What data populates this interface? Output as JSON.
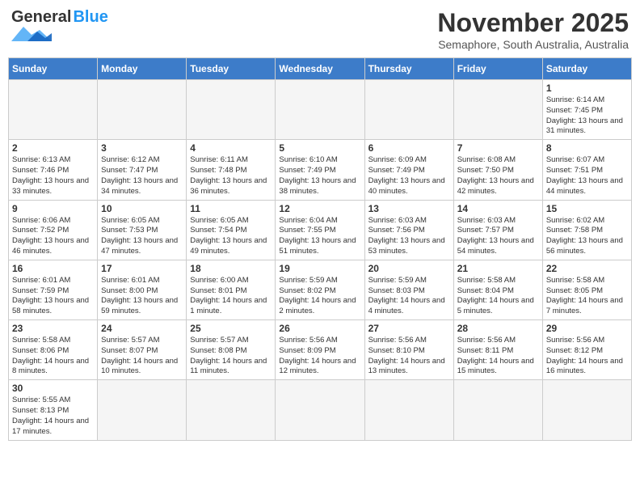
{
  "header": {
    "logo_general": "General",
    "logo_blue": "Blue",
    "title": "November 2025",
    "location": "Semaphore, South Australia, Australia"
  },
  "days_of_week": [
    "Sunday",
    "Monday",
    "Tuesday",
    "Wednesday",
    "Thursday",
    "Friday",
    "Saturday"
  ],
  "weeks": [
    [
      {
        "day": "",
        "info": ""
      },
      {
        "day": "",
        "info": ""
      },
      {
        "day": "",
        "info": ""
      },
      {
        "day": "",
        "info": ""
      },
      {
        "day": "",
        "info": ""
      },
      {
        "day": "",
        "info": ""
      },
      {
        "day": "1",
        "info": "Sunrise: 6:14 AM\nSunset: 7:45 PM\nDaylight: 13 hours and 31 minutes."
      }
    ],
    [
      {
        "day": "2",
        "info": "Sunrise: 6:13 AM\nSunset: 7:46 PM\nDaylight: 13 hours and 33 minutes."
      },
      {
        "day": "3",
        "info": "Sunrise: 6:12 AM\nSunset: 7:47 PM\nDaylight: 13 hours and 34 minutes."
      },
      {
        "day": "4",
        "info": "Sunrise: 6:11 AM\nSunset: 7:48 PM\nDaylight: 13 hours and 36 minutes."
      },
      {
        "day": "5",
        "info": "Sunrise: 6:10 AM\nSunset: 7:49 PM\nDaylight: 13 hours and 38 minutes."
      },
      {
        "day": "6",
        "info": "Sunrise: 6:09 AM\nSunset: 7:49 PM\nDaylight: 13 hours and 40 minutes."
      },
      {
        "day": "7",
        "info": "Sunrise: 6:08 AM\nSunset: 7:50 PM\nDaylight: 13 hours and 42 minutes."
      },
      {
        "day": "8",
        "info": "Sunrise: 6:07 AM\nSunset: 7:51 PM\nDaylight: 13 hours and 44 minutes."
      }
    ],
    [
      {
        "day": "9",
        "info": "Sunrise: 6:06 AM\nSunset: 7:52 PM\nDaylight: 13 hours and 46 minutes."
      },
      {
        "day": "10",
        "info": "Sunrise: 6:05 AM\nSunset: 7:53 PM\nDaylight: 13 hours and 47 minutes."
      },
      {
        "day": "11",
        "info": "Sunrise: 6:05 AM\nSunset: 7:54 PM\nDaylight: 13 hours and 49 minutes."
      },
      {
        "day": "12",
        "info": "Sunrise: 6:04 AM\nSunset: 7:55 PM\nDaylight: 13 hours and 51 minutes."
      },
      {
        "day": "13",
        "info": "Sunrise: 6:03 AM\nSunset: 7:56 PM\nDaylight: 13 hours and 53 minutes."
      },
      {
        "day": "14",
        "info": "Sunrise: 6:03 AM\nSunset: 7:57 PM\nDaylight: 13 hours and 54 minutes."
      },
      {
        "day": "15",
        "info": "Sunrise: 6:02 AM\nSunset: 7:58 PM\nDaylight: 13 hours and 56 minutes."
      }
    ],
    [
      {
        "day": "16",
        "info": "Sunrise: 6:01 AM\nSunset: 7:59 PM\nDaylight: 13 hours and 58 minutes."
      },
      {
        "day": "17",
        "info": "Sunrise: 6:01 AM\nSunset: 8:00 PM\nDaylight: 13 hours and 59 minutes."
      },
      {
        "day": "18",
        "info": "Sunrise: 6:00 AM\nSunset: 8:01 PM\nDaylight: 14 hours and 1 minute."
      },
      {
        "day": "19",
        "info": "Sunrise: 5:59 AM\nSunset: 8:02 PM\nDaylight: 14 hours and 2 minutes."
      },
      {
        "day": "20",
        "info": "Sunrise: 5:59 AM\nSunset: 8:03 PM\nDaylight: 14 hours and 4 minutes."
      },
      {
        "day": "21",
        "info": "Sunrise: 5:58 AM\nSunset: 8:04 PM\nDaylight: 14 hours and 5 minutes."
      },
      {
        "day": "22",
        "info": "Sunrise: 5:58 AM\nSunset: 8:05 PM\nDaylight: 14 hours and 7 minutes."
      }
    ],
    [
      {
        "day": "23",
        "info": "Sunrise: 5:58 AM\nSunset: 8:06 PM\nDaylight: 14 hours and 8 minutes."
      },
      {
        "day": "24",
        "info": "Sunrise: 5:57 AM\nSunset: 8:07 PM\nDaylight: 14 hours and 10 minutes."
      },
      {
        "day": "25",
        "info": "Sunrise: 5:57 AM\nSunset: 8:08 PM\nDaylight: 14 hours and 11 minutes."
      },
      {
        "day": "26",
        "info": "Sunrise: 5:56 AM\nSunset: 8:09 PM\nDaylight: 14 hours and 12 minutes."
      },
      {
        "day": "27",
        "info": "Sunrise: 5:56 AM\nSunset: 8:10 PM\nDaylight: 14 hours and 13 minutes."
      },
      {
        "day": "28",
        "info": "Sunrise: 5:56 AM\nSunset: 8:11 PM\nDaylight: 14 hours and 15 minutes."
      },
      {
        "day": "29",
        "info": "Sunrise: 5:56 AM\nSunset: 8:12 PM\nDaylight: 14 hours and 16 minutes."
      }
    ],
    [
      {
        "day": "30",
        "info": "Sunrise: 5:55 AM\nSunset: 8:13 PM\nDaylight: 14 hours and 17 minutes."
      },
      {
        "day": "",
        "info": ""
      },
      {
        "day": "",
        "info": ""
      },
      {
        "day": "",
        "info": ""
      },
      {
        "day": "",
        "info": ""
      },
      {
        "day": "",
        "info": ""
      },
      {
        "day": "",
        "info": ""
      }
    ]
  ]
}
